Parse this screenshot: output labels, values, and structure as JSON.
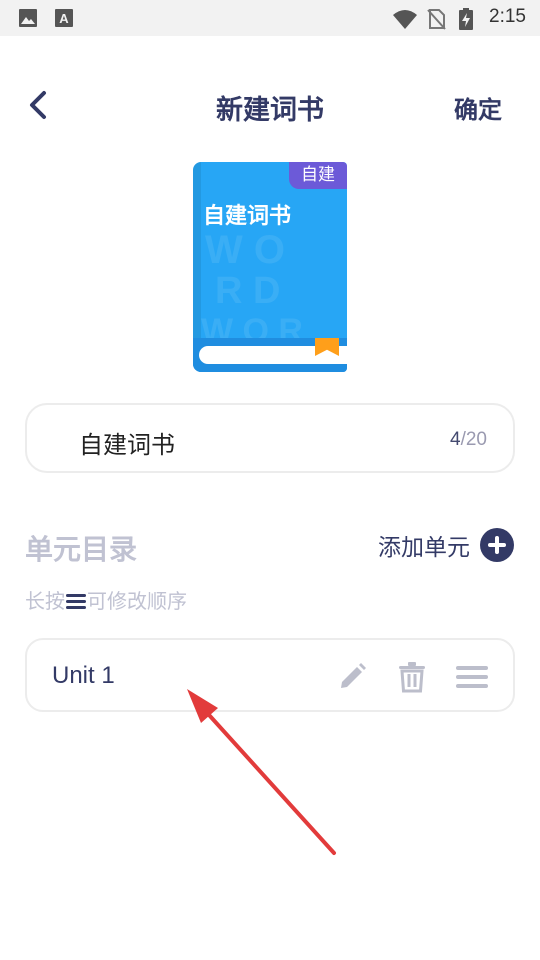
{
  "status_bar": {
    "time": "2:15",
    "left_icons": [
      "image-icon",
      "font-icon"
    ],
    "right_icons": [
      "wifi-icon",
      "no-sim-icon",
      "battery-charging-icon"
    ]
  },
  "nav": {
    "title": "新建词书",
    "confirm_label": "确定",
    "back_icon": "chevron-left-icon"
  },
  "book": {
    "tag": "自建",
    "cover_title": "自建词书",
    "cover_color": "#27a6f5",
    "tag_color": "#6c5ad8",
    "ribbon_color": "#ff9f1a"
  },
  "name_field": {
    "value": "自建词书",
    "count_current": "4",
    "count_max": "/20"
  },
  "units_section": {
    "title": "单元目录",
    "add_label": "添加单元",
    "hint_prefix": "长按",
    "hint_suffix": "可修改顺序",
    "units": [
      {
        "name": "Unit 1"
      }
    ]
  },
  "colors": {
    "primary": "#333a66",
    "muted": "#c0c2d2",
    "annotation_arrow": "#e23b3b"
  }
}
